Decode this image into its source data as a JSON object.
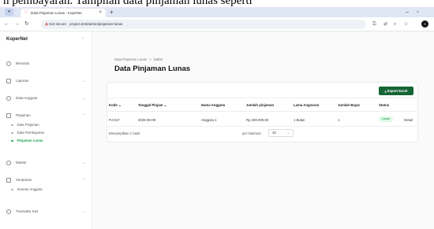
{
  "caption": "n pembayaran. Tampilan data pinjaman lunas seperti",
  "browser": {
    "tab_title": "Data Pinjaman Lunas - KoperNe",
    "new_tab": "+",
    "address_warning": "Not secure",
    "address_url": "project.test/admin/pinjaman-lunas",
    "profile_initial": "S"
  },
  "sidebar": {
    "brand": "KoperNet",
    "items": [
      {
        "label": "Beranda"
      },
      {
        "label": "Laporan"
      },
      {
        "label": "Data Anggota"
      },
      {
        "label": "Pinjaman"
      },
      {
        "label": "Master"
      },
      {
        "label": "Simpanan"
      },
      {
        "label": "Transaksi Kas"
      }
    ],
    "pinjaman_sub": [
      "Data Pinjaman",
      "Data Pembayaran",
      "Pinjaman Lunas"
    ],
    "simpanan_sub": [
      "Setoran Anggota"
    ]
  },
  "main": {
    "breadcrumb": [
      "Data Pinjaman Lunas",
      "Daftar"
    ],
    "breadcrumb_sep": ">",
    "title": "Data Pinjaman Lunas",
    "export_label": "Export Excel",
    "columns": [
      "Kode",
      "Tanggal Pinjam",
      "Nama Anggota",
      "Jumlah pinjaman",
      "Lama Angsuran",
      "Jumlah Bayar",
      "Status"
    ],
    "row": {
      "kode": "PJ-017",
      "tanggal": "2025-06-09",
      "nama": "Anggota 1",
      "jumlah": "Rp 200.000,00",
      "lama": "1 Bulan",
      "bayar": "1",
      "status": "Lunas",
      "action": "Detail"
    },
    "showing": "Menampilkan 1 hasil",
    "per_page_label": "per halaman",
    "per_page_value": "10"
  },
  "colors": {
    "accent": "#166534",
    "active_nav": "#16a34a",
    "badge_bg": "#dcfce7"
  }
}
